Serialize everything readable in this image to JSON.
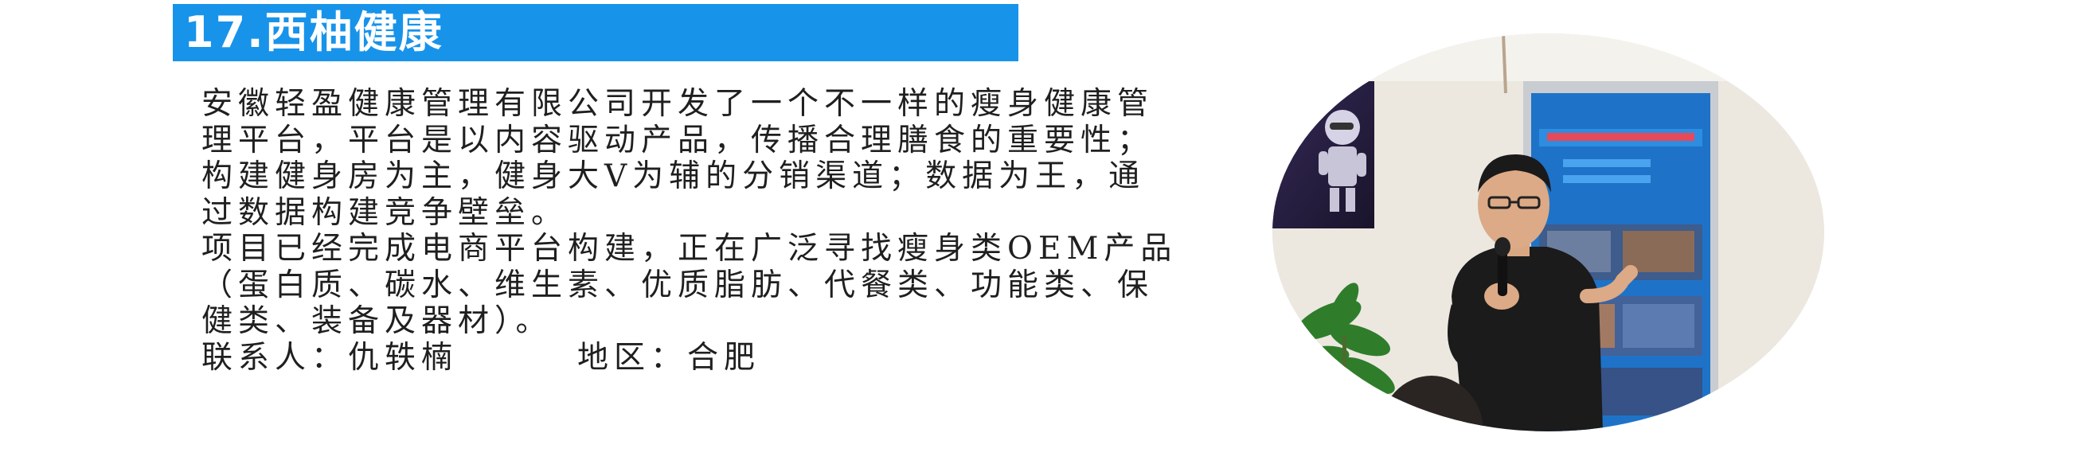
{
  "section": {
    "title": "17.西柚健康"
  },
  "content": {
    "lines": [
      "安徽轻盈健康管理有限公司开发了一个不一样的瘦身健康管",
      "理平台，平台是以内容驱动产品，传播合理膳食的重要性；",
      "构建健身房为主，健身大V为辅的分销渠道；数据为王，通",
      "过数据构建竞争壁垒。",
      "项目已经完成电商平台构建，正在广泛寻找瘦身类OEM产品",
      "（蛋白质、碳水、维生素、优质脂肪、代餐类、功能类、保",
      "健类、装备及器材）。"
    ],
    "contact_label": "联系人：仇轶楠",
    "region_label": "地区：合肥"
  },
  "photo": {
    "description_icon": "presenter-photo",
    "colors": {
      "wall": "#ece8e0",
      "banner": "#1e73c8",
      "shirt": "#1b1b1b",
      "plant": "#2f7d2a"
    }
  },
  "colors": {
    "title_bar": "#1893ea",
    "title_text": "#ffffff",
    "body_text": "#1f1f1f"
  }
}
